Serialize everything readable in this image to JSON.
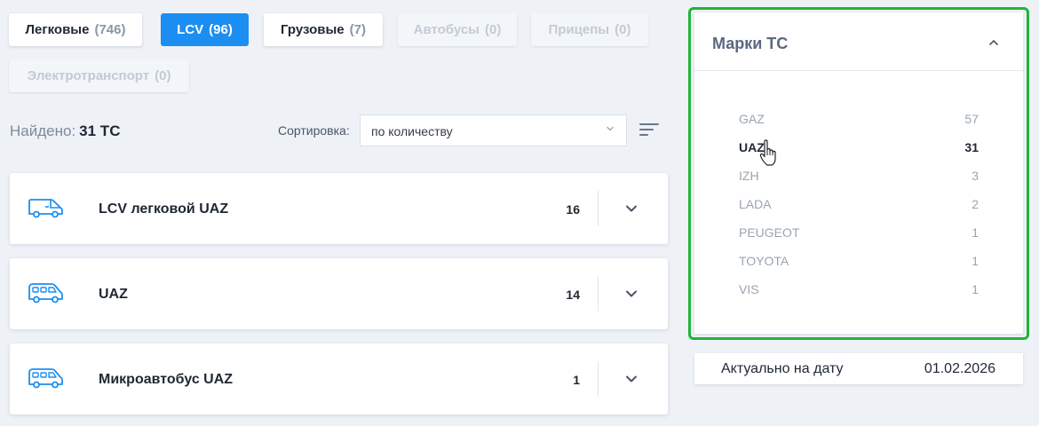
{
  "tabs": [
    {
      "label": "Легковые",
      "count": "(746)",
      "state": "normal"
    },
    {
      "label": "LCV",
      "count": "(96)",
      "state": "active"
    },
    {
      "label": "Грузовые",
      "count": "(7)",
      "state": "normal"
    },
    {
      "label": "Автобусы",
      "count": "(0)",
      "state": "disabled"
    },
    {
      "label": "Прицепы",
      "count": "(0)",
      "state": "disabled"
    },
    {
      "label": "Электротранспорт",
      "count": "(0)",
      "state": "disabled"
    }
  ],
  "results": {
    "found_label": "Найдено:",
    "found_value": "31 ТС"
  },
  "sort": {
    "label": "Сортировка:",
    "value": "по количеству"
  },
  "vehicles": [
    {
      "name": "LCV легковой UAZ",
      "count": "16",
      "icon": "light-van-icon"
    },
    {
      "name": "UAZ",
      "count": "14",
      "icon": "minivan-icon"
    },
    {
      "name": "Микроавтобус UAZ",
      "count": "1",
      "icon": "minibus-icon"
    }
  ],
  "brands": {
    "title": "Марки ТС",
    "items": [
      {
        "name": "GAZ",
        "count": "57",
        "selected": false
      },
      {
        "name": "UAZ",
        "count": "31",
        "selected": true
      },
      {
        "name": "IZH",
        "count": "3",
        "selected": false
      },
      {
        "name": "LADA",
        "count": "2",
        "selected": false
      },
      {
        "name": "PEUGEOT",
        "count": "1",
        "selected": false
      },
      {
        "name": "TOYOTA",
        "count": "1",
        "selected": false
      },
      {
        "name": "VIS",
        "count": "1",
        "selected": false
      }
    ]
  },
  "date": {
    "label": "Актуально на дату",
    "value": "01.02.2026"
  },
  "colors": {
    "accent": "#1c8ef2",
    "highlight_border": "#22b33a",
    "icon_blue": "#1c8ef2"
  }
}
